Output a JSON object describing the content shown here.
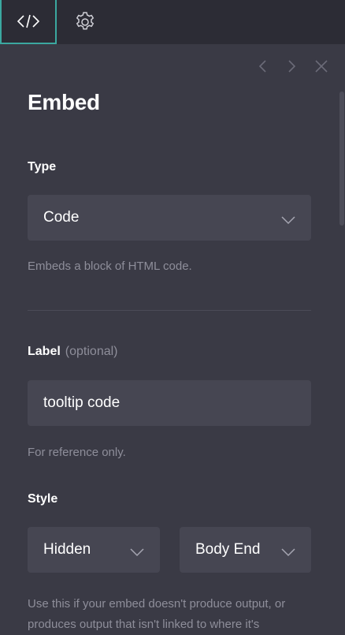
{
  "tabs": {
    "embed_icon": "code-icon",
    "settings_icon": "gear-icon"
  },
  "nav": {
    "prev_icon": "chevron-left-icon",
    "next_icon": "chevron-right-icon",
    "close_icon": "close-icon"
  },
  "panel": {
    "title": "Embed",
    "type": {
      "label": "Type",
      "value": "Code",
      "help": "Embeds a block of HTML code."
    },
    "label_field": {
      "label": "Label",
      "optional": "(optional)",
      "value": "tooltip code",
      "help": "For reference only."
    },
    "style": {
      "label": "Style",
      "visibility_value": "Hidden",
      "position_value": "Body End",
      "help_line1": "Use this if your embed doesn't produce output, or",
      "help_line2": "produces output that isn't linked to where it's"
    }
  },
  "colors": {
    "accent": "#3ba8a0",
    "background": "#3a3a45",
    "topbar": "#2c2c35",
    "field": "#464652"
  }
}
